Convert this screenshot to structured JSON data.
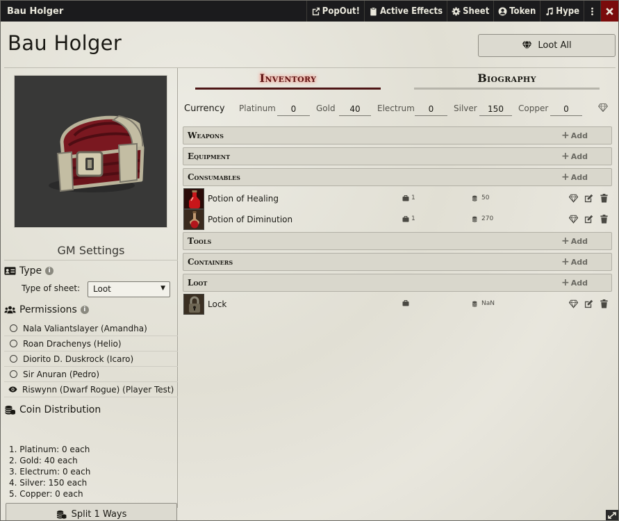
{
  "window": {
    "title": "Bau Holger",
    "buttons": [
      {
        "label": "PopOut!",
        "icon": "external-link-icon"
      },
      {
        "label": "Active Effects",
        "icon": "clipboard-icon"
      },
      {
        "label": "Sheet",
        "icon": "gear-icon"
      },
      {
        "label": "Token",
        "icon": "user-circle-icon"
      },
      {
        "label": "Hype",
        "icon": "music-icon"
      }
    ]
  },
  "header": {
    "actor_name": "Bau Holger",
    "loot_all_label": "Loot All"
  },
  "sidebar": {
    "gm_settings_title": "GM Settings",
    "type_title": "Type",
    "type_of_sheet_label": "Type of sheet:",
    "type_of_sheet_value": "Loot",
    "permissions_title": "Permissions",
    "players": [
      {
        "name": "Nala Valiantslayer (Amandha)",
        "state": "none"
      },
      {
        "name": "Roan Drachenys (Helio)",
        "state": "none"
      },
      {
        "name": "Diorito D. Duskrock (Icaro)",
        "state": "none"
      },
      {
        "name": "Sir Anuran (Pedro)",
        "state": "none"
      },
      {
        "name": "Riswynn (Dwarf Rogue) (Player Test)",
        "state": "observer"
      }
    ],
    "coin_distribution_title": "Coin Distribution",
    "coin_distribution": [
      "1. Platinum: 0 each",
      "2. Gold: 40 each",
      "3. Electrum: 0 each",
      "4. Silver: 150 each",
      "5. Copper: 0 each"
    ],
    "split_label": "Split 1 Ways"
  },
  "tabs": [
    {
      "label": "Inventory",
      "active": true
    },
    {
      "label": "Biography",
      "active": false
    }
  ],
  "currency": {
    "label": "Currency",
    "coins": [
      {
        "name": "Platinum",
        "value": "0"
      },
      {
        "name": "Gold",
        "value": "40"
      },
      {
        "name": "Electrum",
        "value": "0"
      },
      {
        "name": "Silver",
        "value": "150"
      },
      {
        "name": "Copper",
        "value": "0"
      }
    ]
  },
  "inventory": {
    "add_label": "Add",
    "sections": [
      {
        "title": "Weapons",
        "items": []
      },
      {
        "title": "Equipment",
        "items": []
      },
      {
        "title": "Consumables",
        "items": [
          {
            "name": "Potion of Healing",
            "quantity": "1",
            "price": "50"
          },
          {
            "name": "Potion of Diminution",
            "quantity": "1",
            "price": "270"
          }
        ]
      },
      {
        "title": "Tools",
        "items": []
      },
      {
        "title": "Containers",
        "items": []
      },
      {
        "title": "Loot",
        "items": [
          {
            "name": "Lock",
            "quantity": "",
            "price": "NaN"
          }
        ]
      }
    ]
  },
  "colors": {
    "title_bar": "#1b1b1d",
    "close_button": "#7a0c0c",
    "active_tab": "#5d1414",
    "parchment": "#e4e2d8"
  }
}
